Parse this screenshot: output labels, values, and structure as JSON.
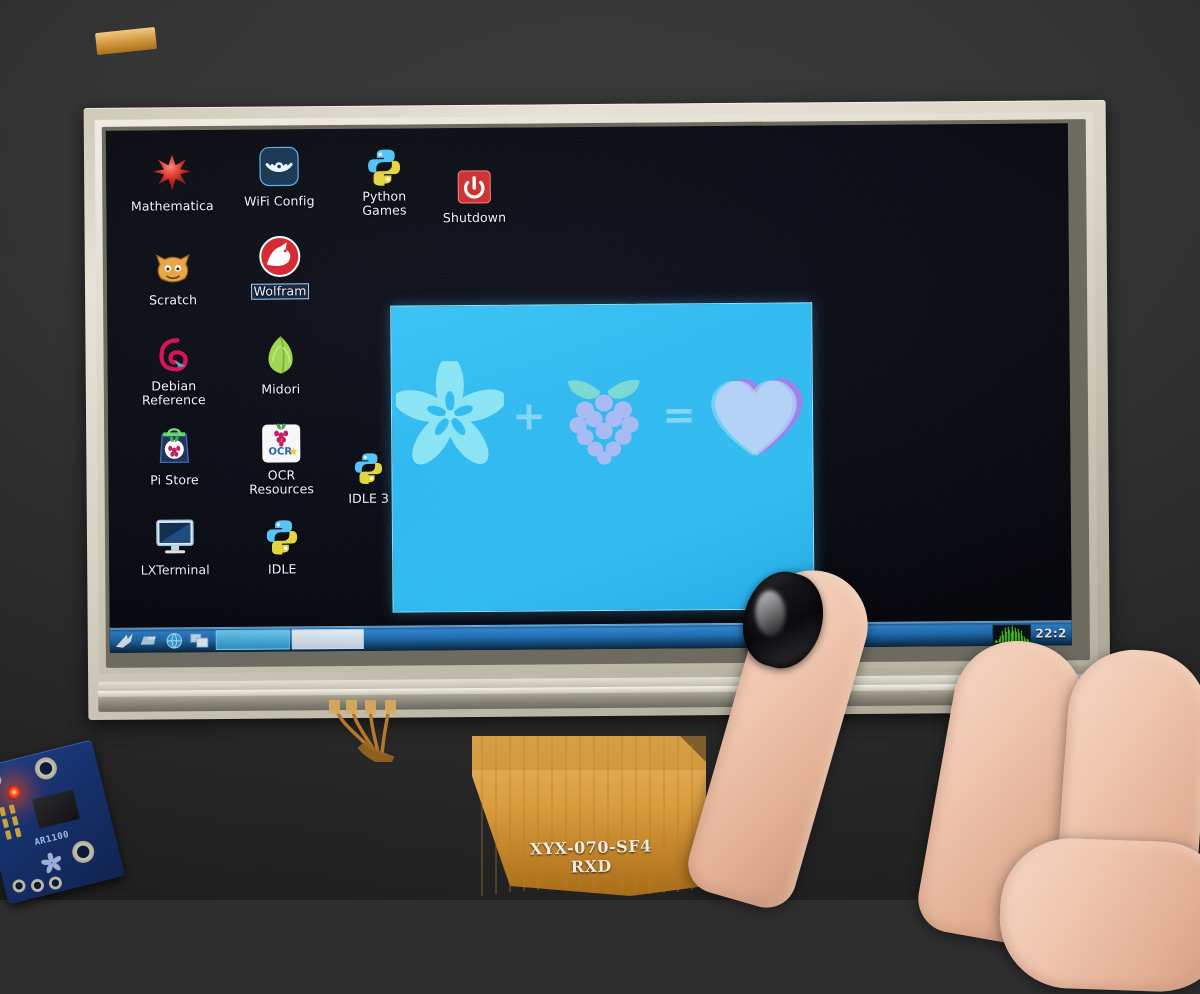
{
  "scene": {
    "title": "Adafruit 7 inch resistive touchscreen LCD attached to Raspberry Pi, finger touching display",
    "backdrop_color": "#2e2e2e",
    "bezel_color": "#d8d3c3"
  },
  "display": {
    "screen_background": "#07080c",
    "desktop_environment": "LXDE",
    "icons": [
      {
        "name": "Mathematica",
        "icon": "mathematica-star-icon",
        "color": "#e0392c",
        "selected": false
      },
      {
        "name": "WiFi Config",
        "icon": "wifi-config-icon",
        "color": "#2f9fe0",
        "selected": false
      },
      {
        "name": "Python\nGames",
        "icon": "python-icon",
        "color": "#4fc3f7",
        "selected": false
      },
      {
        "name": "Shutdown",
        "icon": "power-icon",
        "color": "#cc2b2b",
        "selected": false
      },
      {
        "name": "Scratch",
        "icon": "scratch-cat-icon",
        "color": "#e8a33d",
        "selected": false
      },
      {
        "name": "Wolfram",
        "icon": "wolfram-icon",
        "color": "#d2232a",
        "selected": true
      },
      {
        "name": "Debian\nReference",
        "icon": "debian-swirl-icon",
        "color": "#d70a53",
        "selected": false
      },
      {
        "name": "Midori",
        "icon": "midori-leaf-icon",
        "color": "#9ed54c",
        "selected": false
      },
      {
        "name": "Pi Store",
        "icon": "pi-store-bag-icon",
        "color": "#1b2f55",
        "selected": false
      },
      {
        "name": "OCR\nResources",
        "icon": "ocr-resources-icon",
        "color": "#f4f4f4",
        "selected": false
      },
      {
        "name": "IDLE 3",
        "icon": "python-icon",
        "color": "#4fc3f7",
        "selected": false
      },
      {
        "name": "LXTerminal",
        "icon": "lxterminal-monitor-icon",
        "color": "#4ea8e0",
        "selected": false
      },
      {
        "name": "IDLE",
        "icon": "python-icon",
        "color": "#4fc3f7",
        "selected": false
      }
    ],
    "wallpaper_image": {
      "name": "adafruit-loves-raspberry-pi",
      "background": "#2ab9f0",
      "border": "#8fe3ff",
      "elements": [
        {
          "symbol": "adafruit-flower-icon"
        },
        {
          "symbol": "plus-sign",
          "text": "+"
        },
        {
          "symbol": "raspberry-pi-icon"
        },
        {
          "symbol": "equals-sign",
          "text": "="
        },
        {
          "symbol": "heart-icon"
        }
      ]
    },
    "taskbar": {
      "background": "#1f6fb8",
      "launchers": [
        {
          "name": "lxde-menu-button",
          "icon": "lxde-bird-icon"
        },
        {
          "name": "file-manager-launcher",
          "icon": "folder-icon"
        },
        {
          "name": "web-browser-launcher",
          "icon": "globe-icon"
        },
        {
          "name": "show-desktop-button",
          "icon": "windows-stack-icon"
        }
      ],
      "task_buttons": [
        {
          "label": "",
          "active": true
        },
        {
          "label": "",
          "active": false
        }
      ],
      "tray": {
        "cpu_monitor": {
          "name": "cpu-usage-monitor",
          "color": "#55ee22",
          "samples": [
            10,
            14,
            9,
            22,
            38,
            70,
            45,
            86,
            60,
            92,
            74,
            58,
            96,
            70,
            88,
            62,
            80,
            54,
            66,
            40,
            30,
            22,
            18,
            12
          ]
        },
        "clock": "22:2"
      }
    }
  },
  "hardware": {
    "ribbon_cable_label": "XYX-070-SF4\nRXD",
    "ribbon_cable_line1": "XYX-070-SF4",
    "ribbon_cable_line2": "RXD",
    "breakout_board": {
      "name": "adafruit-ar1100-usb-touchscreen-controller",
      "part_number": "AR1100",
      "pcb_color": "#16306b",
      "led_color": "#ff5a20",
      "led_state": "on"
    }
  }
}
